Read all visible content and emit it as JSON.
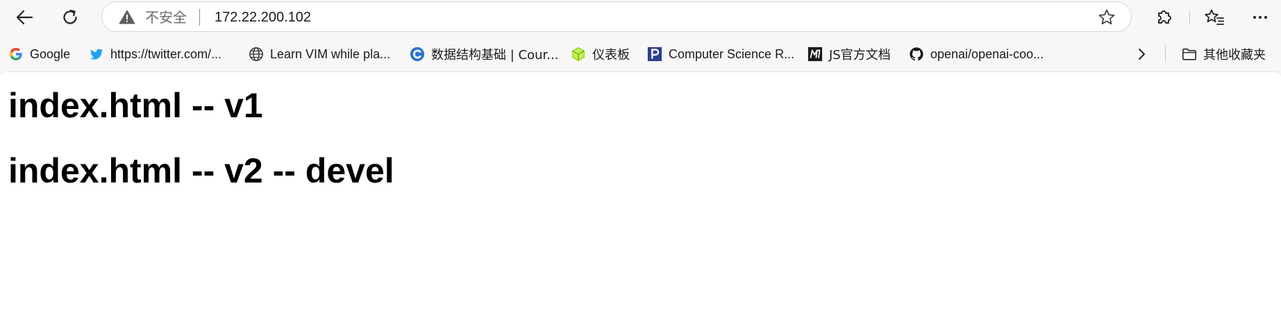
{
  "toolbar": {
    "back_icon": "back-arrow-icon",
    "refresh_icon": "refresh-icon",
    "security_label": "不安全",
    "url": "172.22.200.102",
    "favorite_icon": "star-icon",
    "extensions_icon": "puzzle-icon",
    "favorites_icon": "favorites-star-icon",
    "more_icon": "more-dots-icon"
  },
  "bookmarks": {
    "items": [
      {
        "label": "Google",
        "icon": "google-icon"
      },
      {
        "label": "https://twitter.com/...",
        "icon": "twitter-icon"
      },
      {
        "label": "Learn VIM while pla...",
        "icon": "globe-icon"
      },
      {
        "label": "数据结构基础 | Cour...",
        "icon": "c-logo-icon"
      },
      {
        "label": "仪表板",
        "icon": "cube-icon"
      },
      {
        "label": "Computer Science R...",
        "icon": "p-logo-icon"
      },
      {
        "label": "JS官方文档",
        "icon": "m-logo-icon"
      },
      {
        "label": "openai/openai-coo...",
        "icon": "github-icon"
      }
    ],
    "overflow_icon": "chevron-right-icon",
    "other_folder": {
      "label": "其他收藏夹",
      "icon": "folder-icon"
    }
  },
  "page": {
    "heading_1": "index.html -- v1",
    "heading_2": "index.html -- v2 -- devel"
  }
}
